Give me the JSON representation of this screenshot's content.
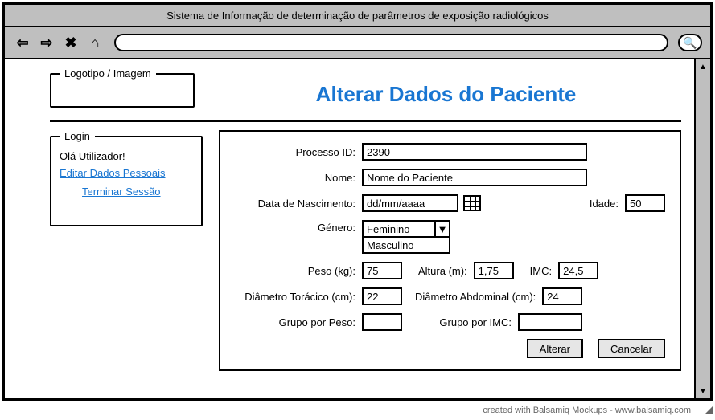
{
  "window": {
    "title": "Sistema de Informação de determinação de parâmetros de exposição radiológicos"
  },
  "header": {
    "logo_legend": "Logotipo / Imagem",
    "page_title": "Alterar Dados do Paciente"
  },
  "login": {
    "legend": "Login",
    "greeting": "Olá Utilizador!",
    "edit_link": "Editar Dados Pessoais",
    "logout_link": "Terminar Sessão"
  },
  "form": {
    "labels": {
      "processo_id": "Processo ID:",
      "nome": "Nome:",
      "data_nascimento": "Data de Nascimento:",
      "idade": "Idade:",
      "genero": "Género:",
      "peso": "Peso (kg):",
      "altura": "Altura (m):",
      "imc": "IMC:",
      "diam_toracico": "Diâmetro Torácico (cm):",
      "diam_abdominal": "Diâmetro Abdominal (cm):",
      "grupo_peso": "Grupo por Peso:",
      "grupo_imc": "Grupo por IMC:"
    },
    "values": {
      "processo_id": "2390",
      "nome": "Nome do Paciente",
      "data_nascimento": "dd/mm/aaaa",
      "idade": "50",
      "genero_selected": "Feminino",
      "genero_option": "Masculino",
      "peso": "75",
      "altura": "1,75",
      "imc": "24,5",
      "diam_toracico": "22",
      "diam_abdominal": "24",
      "grupo_peso": "",
      "grupo_imc": ""
    },
    "buttons": {
      "alterar": "Alterar",
      "cancelar": "Cancelar"
    }
  },
  "footer": {
    "credit": "created with Balsamiq Mockups - www.balsamiq.com"
  }
}
